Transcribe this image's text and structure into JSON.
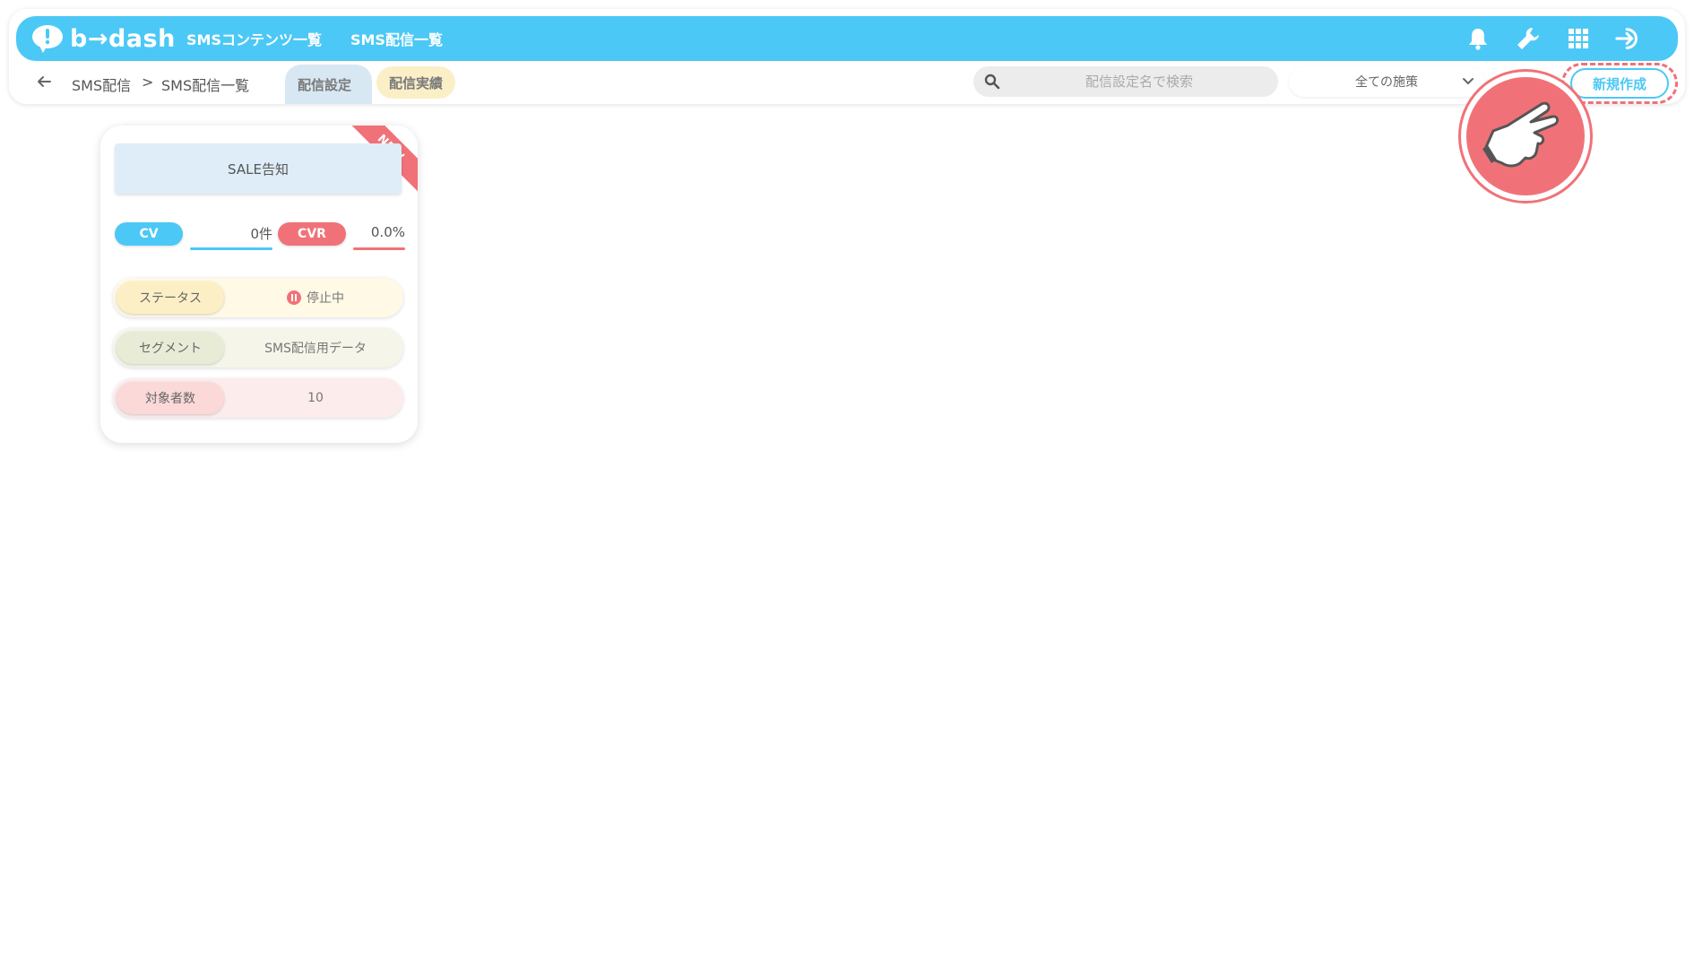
{
  "app": {
    "logo_text": "b→dash"
  },
  "topnav": [
    {
      "label": "SMSコンテンツ一覧"
    },
    {
      "label": "SMS配信一覧"
    }
  ],
  "top_icons": [
    "bell-icon",
    "wrench-icon",
    "grid-icon",
    "logout-icon"
  ],
  "breadcrumb": {
    "root": "SMS配信",
    "separator": ">",
    "current": "SMS配信一覧"
  },
  "tabs": [
    {
      "label": "配信設定",
      "active": true
    },
    {
      "label": "配信実績",
      "active": false
    }
  ],
  "search": {
    "placeholder": "配信設定名で検索"
  },
  "filter_select": {
    "value": "全ての施策"
  },
  "new_button": {
    "label": "新規作成"
  },
  "cards": [
    {
      "title": "SALE告知",
      "badge": "NEW",
      "cv_label": "CV",
      "cv_value": "0件",
      "cvr_label": "CVR",
      "cvr_value": "0.0%",
      "rows": [
        {
          "label": "ステータス",
          "value": "停止中"
        },
        {
          "label": "セグメント",
          "value": "SMS配信用データ"
        },
        {
          "label": "対象者数",
          "value": "10"
        }
      ]
    }
  ],
  "colors": {
    "brand": "#4cc8f6",
    "accent": "#f07278",
    "tab_settings_bg": "#d8e8f3",
    "tab_results_bg": "#fbefc8"
  }
}
